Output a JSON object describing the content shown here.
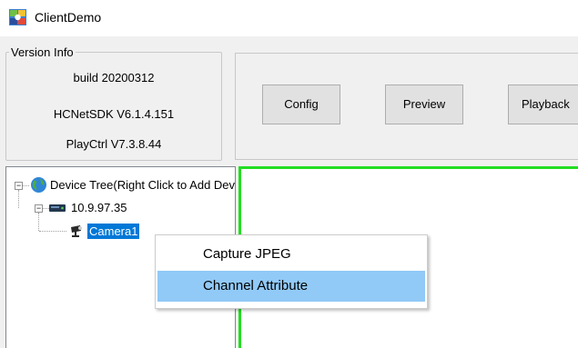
{
  "window": {
    "title": "ClientDemo"
  },
  "version_info": {
    "legend": "Version Info",
    "build": "build 20200312",
    "sdk": "HCNetSDK V6.1.4.151",
    "playctrl": "PlayCtrl V7.3.8.44"
  },
  "toolbar": {
    "config": "Config",
    "preview": "Preview",
    "playback": "Playback"
  },
  "tree": {
    "root": "Device Tree(Right Click to Add Device)",
    "device": "10.9.97.35",
    "camera": "Camera1"
  },
  "context_menu": {
    "items": [
      "Capture JPEG",
      "Channel Attribute"
    ],
    "highlighted": "Channel Attribute"
  },
  "colors": {
    "selection": "#0078d7",
    "menu_highlight": "#91c9f7",
    "video_border": "#22dd22"
  }
}
